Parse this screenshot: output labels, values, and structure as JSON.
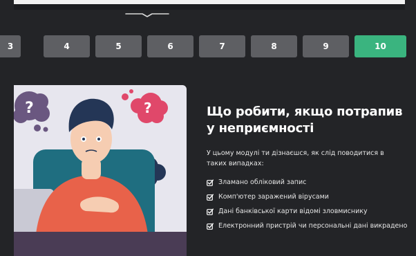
{
  "pager": {
    "pages": [
      {
        "label": "3",
        "active": false
      },
      {
        "label": "4",
        "active": false
      },
      {
        "label": "5",
        "active": false
      },
      {
        "label": "6",
        "active": false
      },
      {
        "label": "7",
        "active": false
      },
      {
        "label": "8",
        "active": false
      },
      {
        "label": "9",
        "active": false
      },
      {
        "label": "10",
        "active": true
      }
    ]
  },
  "module": {
    "title_line1": "Що робити, якщо потрапив",
    "title_line2": "у неприємності",
    "intro": "У цьому модулі ти дізнаєшся, як слід поводитися в таких випадках:",
    "items": [
      "Зламано обліковий запис",
      "Комп'ютер заражений вірусами",
      "Дані банківської карти відомі зловмиснику",
      "Електронний пристрій чи персональні дані викрадено"
    ]
  },
  "colors": {
    "background": "#232427",
    "page_button": "#5e5f63",
    "page_button_active": "#3ab47f",
    "bubble_purple": "#6a5780",
    "bubble_pink": "#e0486a",
    "bubble_navy": "#243656"
  },
  "icons": {
    "collapse_toggle": "chevron-down-icon",
    "check": "checkbox-checked-icon"
  }
}
